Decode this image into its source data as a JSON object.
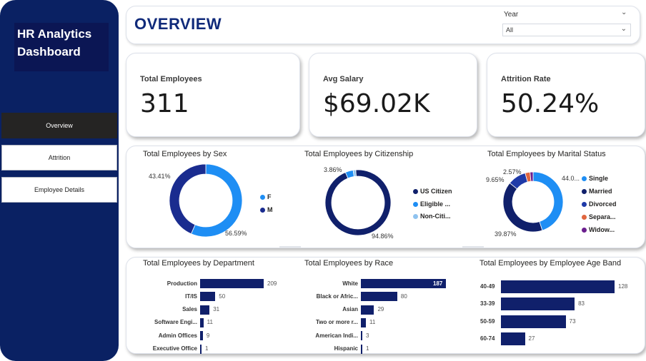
{
  "brand": {
    "title": "HR Analytics Dashboard"
  },
  "nav": [
    {
      "label": "Overview",
      "active": true
    },
    {
      "label": "Attrition",
      "active": false
    },
    {
      "label": "Employee Details",
      "active": false
    }
  ],
  "header": {
    "title": "OVERVIEW",
    "slicer": {
      "label": "Year",
      "value": "All"
    }
  },
  "kpis": [
    {
      "label": "Total Employees",
      "value": "311"
    },
    {
      "label": "Avg Salary",
      "value": "$69.02K"
    },
    {
      "label": "Attrition Rate",
      "value": "50.24%"
    }
  ],
  "colors": {
    "dark_navy": "#10206b",
    "blue": "#1e8ef4",
    "light_blue": "#8fc3ef",
    "orange": "#e0663f",
    "purple": "#6b1f8e",
    "sidebar": "#0a2163"
  },
  "chart_data": [
    {
      "type": "pie",
      "title": "Total Employees by Sex",
      "categories": [
        "F",
        "M"
      ],
      "values": [
        56.59,
        43.41
      ],
      "data_labels": [
        "56.59%",
        "43.41%"
      ],
      "legend": "right"
    },
    {
      "type": "pie",
      "title": "Total Employees by Citizenship",
      "categories": [
        "US Citizen",
        "Eligible ...",
        "Non-Citi..."
      ],
      "values": [
        94.86,
        3.86,
        1.28
      ],
      "data_labels": [
        "94.86%",
        "3.86%"
      ],
      "legend": "right"
    },
    {
      "type": "pie",
      "title": "Total Employees by Marital Status",
      "categories": [
        "Single",
        "Married",
        "Divorced",
        "Separa...",
        "Widow..."
      ],
      "values": [
        44.0,
        39.87,
        9.65,
        2.57,
        1.61
      ],
      "data_labels": [
        "44.0...",
        "39.87%",
        "9.65%",
        "2.57%"
      ],
      "legend": "right"
    },
    {
      "type": "bar",
      "title": "Total Employees by Department",
      "categories": [
        "Production",
        "IT/IS",
        "Sales",
        "Software Engi...",
        "Admin Offices",
        "Executive Office"
      ],
      "values": [
        209,
        50,
        31,
        11,
        9,
        1
      ],
      "data_labels": [
        "209",
        "50",
        "31",
        "11",
        "9",
        "1"
      ]
    },
    {
      "type": "bar",
      "title": "Total Employees by Race",
      "categories": [
        "White",
        "Black or Afric...",
        "Asian",
        "Two or more r...",
        "American Indi...",
        "Hispanic"
      ],
      "values": [
        187,
        80,
        29,
        11,
        3,
        1
      ],
      "data_labels": [
        "187",
        "80",
        "29",
        "11",
        "3",
        "1"
      ]
    },
    {
      "type": "bar",
      "title": "Total Employees by Employee Age Band",
      "categories": [
        "40-49",
        "33-39",
        "50-59",
        "60-74"
      ],
      "values": [
        128,
        83,
        73,
        27
      ],
      "data_labels": [
        "128",
        "83",
        "73",
        "27"
      ]
    }
  ]
}
